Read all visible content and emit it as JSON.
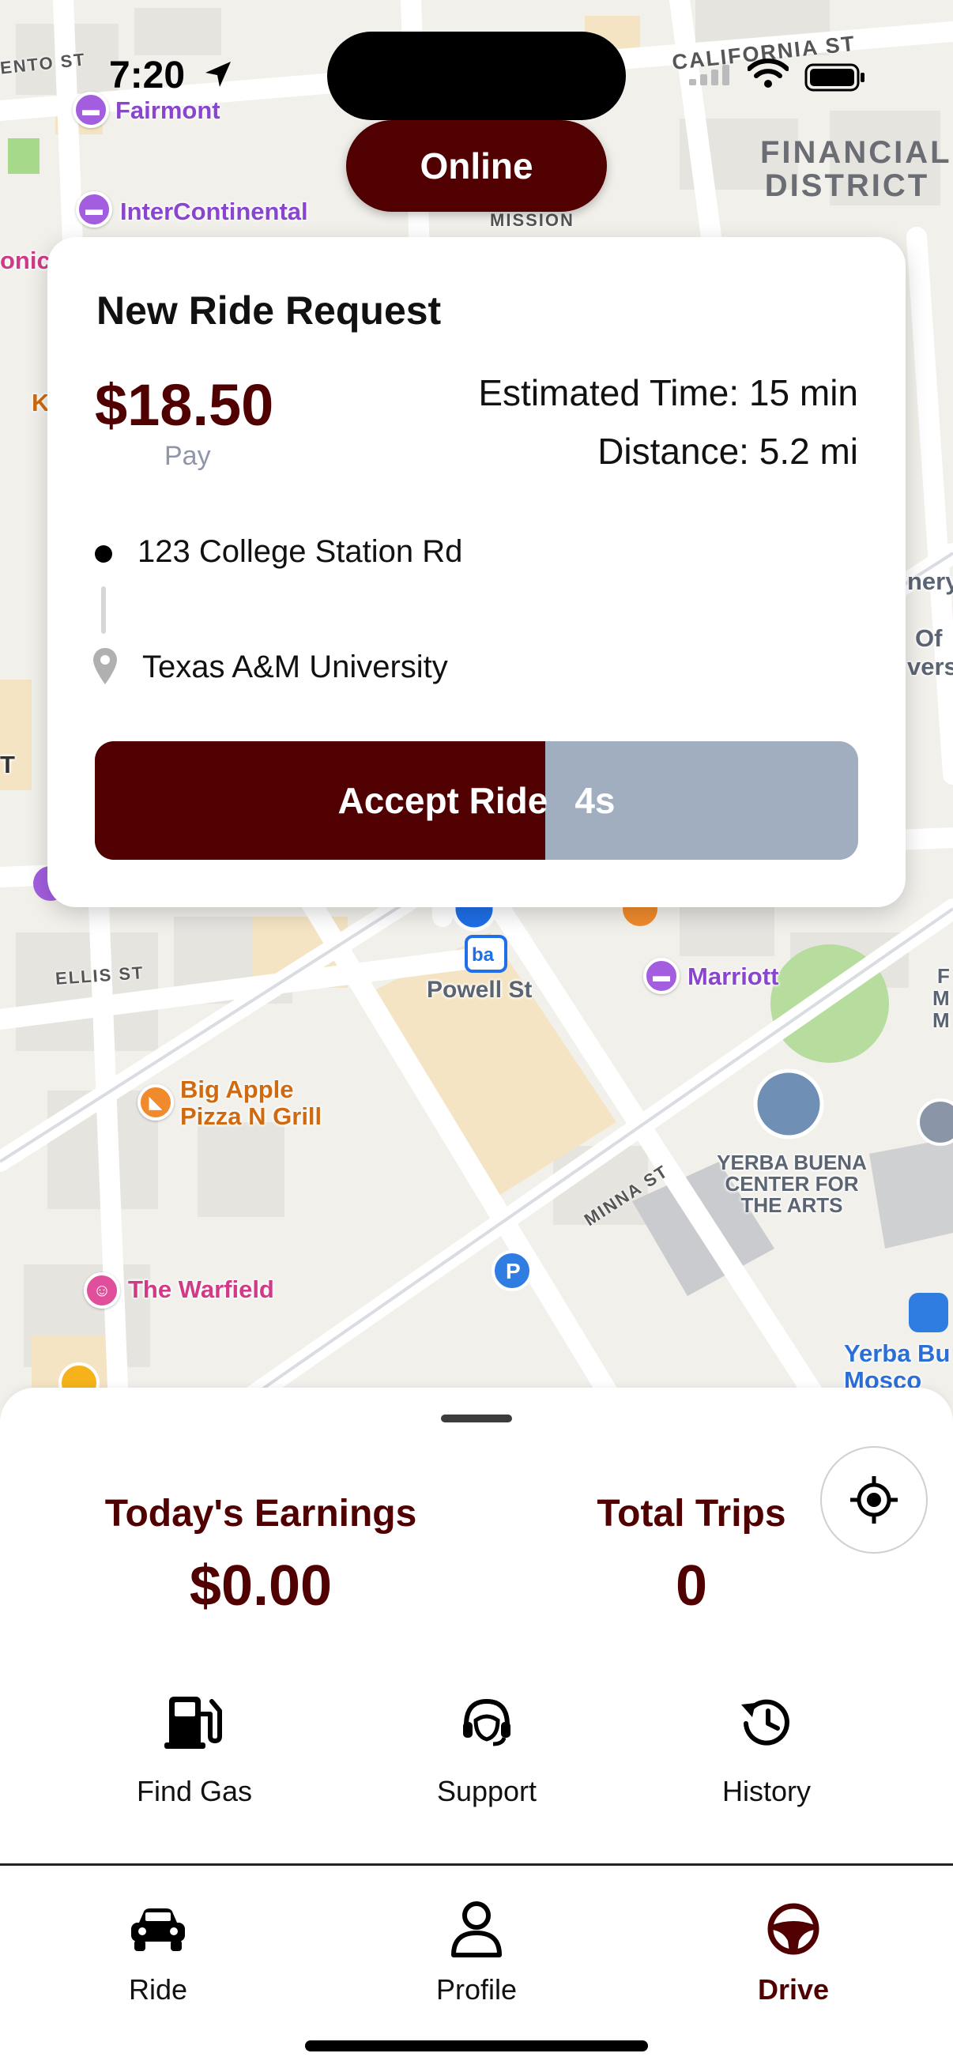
{
  "status_bar": {
    "time": "7:20"
  },
  "map": {
    "pois": [
      {
        "name": "Fairmont",
        "color": "#8a45cf"
      },
      {
        "name": "InterContinental",
        "color": "#8a45cf"
      },
      {
        "name": "Marriott",
        "color": "#8a45cf"
      },
      {
        "name": "Big Apple Pizza N Grill",
        "color": "#e07a1c"
      },
      {
        "name": "The Warfield",
        "color": "#d03a86"
      },
      {
        "name": "YERBA BUENA CENTER FOR THE ARTS",
        "color": "#5b6472"
      },
      {
        "name": "Yerba Bu Mosco",
        "color": "#2a6fd6"
      },
      {
        "name": "Powell St",
        "color": "#5b6472"
      }
    ],
    "district_label": "FINANCIAL DISTRICT",
    "streets": [
      "CALIFORNIA ST",
      "MISSION",
      "ELLIS ST",
      "MINNA ST",
      "ENTO ST"
    ],
    "edge_fragments": {
      "left_1": "onic",
      "left_2": "K",
      "right_1": "nery",
      "right_2": "Of",
      "right_3": "vers",
      "right_4": "F",
      "right_5": "M",
      "right_6": "M",
      "left_3": "T"
    }
  },
  "online_status": "Online",
  "ride_request": {
    "title": "New Ride Request",
    "price": "$18.50",
    "price_caption": "Pay",
    "estimated_time": "Estimated Time: 15 min",
    "distance": "Distance: 5.2 mi",
    "pickup": "123 College Station Rd",
    "destination": "Texas A&M University",
    "accept_label": "Accept Ride",
    "countdown": "4s",
    "countdown_progress": 0.59
  },
  "stats": {
    "earnings_label": "Today's Earnings",
    "earnings_value": "$0.00",
    "trips_label": "Total Trips",
    "trips_value": "0"
  },
  "actions": [
    {
      "label": "Find Gas",
      "icon": "gas-pump-icon"
    },
    {
      "label": "Support",
      "icon": "headset-icon"
    },
    {
      "label": "History",
      "icon": "history-icon"
    }
  ],
  "tabs": [
    {
      "label": "Ride",
      "icon": "car-icon",
      "active": false
    },
    {
      "label": "Profile",
      "icon": "person-icon",
      "active": false
    },
    {
      "label": "Drive",
      "icon": "steering-wheel-icon",
      "active": true
    }
  ],
  "colors": {
    "brand_maroon": "#500000",
    "timer_track": "#a1aebf",
    "pay_caption": "#8e96a8"
  }
}
